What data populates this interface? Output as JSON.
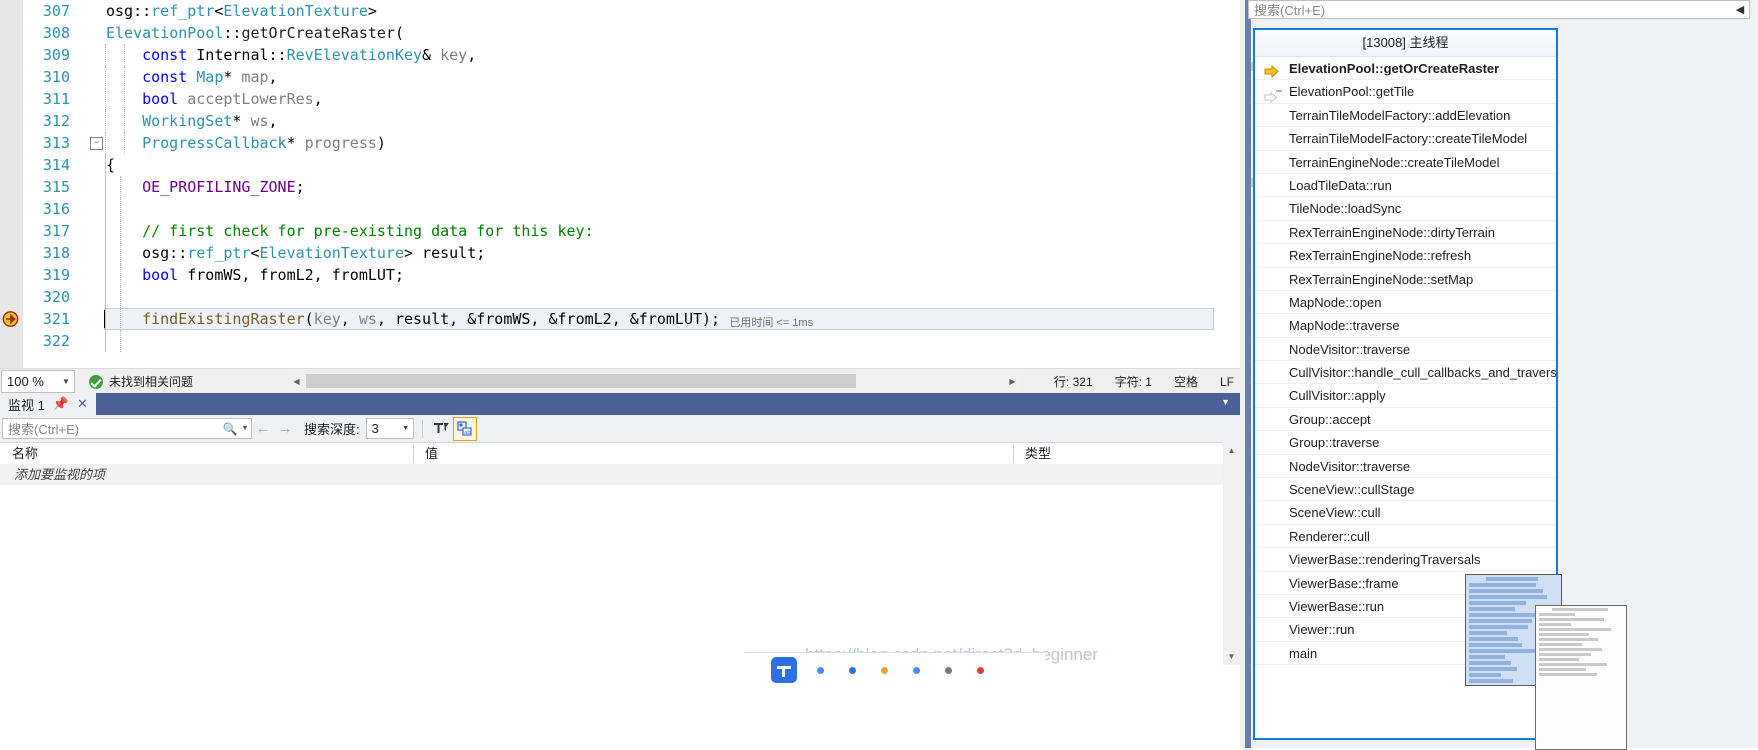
{
  "editor": {
    "lines": [
      {
        "num": "307",
        "indent": 0,
        "tokens": [
          {
            "t": "osg",
            "c": "p"
          },
          {
            "t": "::",
            "c": "p"
          },
          {
            "t": "ref_ptr",
            "c": "t"
          },
          {
            "t": "<",
            "c": "p"
          },
          {
            "t": "ElevationTexture",
            "c": "t"
          },
          {
            "t": ">",
            "c": "p"
          }
        ]
      },
      {
        "num": "308",
        "indent": 0,
        "tokens": [
          {
            "t": "ElevationPool",
            "c": "t"
          },
          {
            "t": "::",
            "c": "p"
          },
          {
            "t": "getOrCreateRaster",
            "c": "id"
          },
          {
            "t": "(",
            "c": "p"
          }
        ]
      },
      {
        "num": "309",
        "indent": 1,
        "tokens": [
          {
            "t": "const",
            "c": "k"
          },
          {
            "t": " ",
            "c": "p"
          },
          {
            "t": "Internal",
            "c": "p"
          },
          {
            "t": "::",
            "c": "p"
          },
          {
            "t": "RevElevationKey",
            "c": "t"
          },
          {
            "t": "&",
            "c": "p"
          },
          {
            "t": " ",
            "c": "p"
          },
          {
            "t": "key",
            "c": "g"
          },
          {
            "t": ",",
            "c": "p"
          }
        ]
      },
      {
        "num": "310",
        "indent": 1,
        "tokens": [
          {
            "t": "const",
            "c": "k"
          },
          {
            "t": " ",
            "c": "p"
          },
          {
            "t": "Map",
            "c": "t"
          },
          {
            "t": "*",
            "c": "p"
          },
          {
            "t": " ",
            "c": "p"
          },
          {
            "t": "map",
            "c": "g"
          },
          {
            "t": ",",
            "c": "p"
          }
        ]
      },
      {
        "num": "311",
        "indent": 1,
        "tokens": [
          {
            "t": "bool",
            "c": "k"
          },
          {
            "t": " ",
            "c": "p"
          },
          {
            "t": "acceptLowerRes",
            "c": "g"
          },
          {
            "t": ",",
            "c": "p"
          }
        ]
      },
      {
        "num": "312",
        "indent": 1,
        "tokens": [
          {
            "t": "WorkingSet",
            "c": "t"
          },
          {
            "t": "*",
            "c": "p"
          },
          {
            "t": " ",
            "c": "p"
          },
          {
            "t": "ws",
            "c": "g"
          },
          {
            "t": ",",
            "c": "p"
          }
        ]
      },
      {
        "num": "313",
        "indent": 1,
        "fold": true,
        "tokens": [
          {
            "t": "ProgressCallback",
            "c": "t"
          },
          {
            "t": "*",
            "c": "p"
          },
          {
            "t": " ",
            "c": "p"
          },
          {
            "t": "progress",
            "c": "g"
          },
          {
            "t": ")",
            "c": "p"
          }
        ]
      },
      {
        "num": "314",
        "indent": 0,
        "tokens": [
          {
            "t": "{",
            "c": "p"
          }
        ]
      },
      {
        "num": "315",
        "indent": 1,
        "tokens": [
          {
            "t": "OE_PROFILING_ZONE",
            "c": "m"
          },
          {
            "t": ";",
            "c": "p"
          }
        ]
      },
      {
        "num": "316",
        "indent": 1,
        "tokens": []
      },
      {
        "num": "317",
        "indent": 1,
        "tokens": [
          {
            "t": "// first check for pre-existing data for this key:",
            "c": "c"
          }
        ]
      },
      {
        "num": "318",
        "indent": 1,
        "tokens": [
          {
            "t": "osg",
            "c": "p"
          },
          {
            "t": "::",
            "c": "p"
          },
          {
            "t": "ref_ptr",
            "c": "t"
          },
          {
            "t": "<",
            "c": "p"
          },
          {
            "t": "ElevationTexture",
            "c": "t"
          },
          {
            "t": "> ",
            "c": "p"
          },
          {
            "t": "result",
            "c": "p"
          },
          {
            "t": ";",
            "c": "p"
          }
        ]
      },
      {
        "num": "319",
        "indent": 1,
        "tokens": [
          {
            "t": "bool",
            "c": "k"
          },
          {
            "t": " ",
            "c": "p"
          },
          {
            "t": "fromWS",
            "c": "p"
          },
          {
            "t": ", ",
            "c": "p"
          },
          {
            "t": "fromL2",
            "c": "p"
          },
          {
            "t": ", ",
            "c": "p"
          },
          {
            "t": "fromLUT",
            "c": "p"
          },
          {
            "t": ";",
            "c": "p"
          }
        ]
      },
      {
        "num": "320",
        "indent": 1,
        "tokens": []
      },
      {
        "num": "321",
        "indent": 1,
        "current": true,
        "tokens": [
          {
            "t": "findExistingRaster",
            "c": "f"
          },
          {
            "t": "(",
            "c": "p"
          },
          {
            "t": "key",
            "c": "g"
          },
          {
            "t": ", ",
            "c": "p"
          },
          {
            "t": "ws",
            "c": "g"
          },
          {
            "t": ", ",
            "c": "p"
          },
          {
            "t": "result",
            "c": "p"
          },
          {
            "t": ", ",
            "c": "p"
          },
          {
            "t": "&fromWS",
            "c": "p"
          },
          {
            "t": ", ",
            "c": "p"
          },
          {
            "t": "&fromL2",
            "c": "p"
          },
          {
            "t": ", ",
            "c": "p"
          },
          {
            "t": "&fromLUT",
            "c": "p"
          },
          {
            "t": ");",
            "c": "p"
          }
        ]
      },
      {
        "num": "322",
        "indent": 1,
        "tokens": []
      }
    ],
    "elapsed_label": "已用时间 <= 1ms"
  },
  "status_bar": {
    "zoom": "100 %",
    "problems": "未找到相关问题",
    "line_label": "行: 321",
    "char_label": "字符: 1",
    "spacing": "空格",
    "eol": "LF"
  },
  "watch": {
    "tab_title": "监视 1",
    "pin_icon": "pin-icon",
    "close_icon": "close-icon",
    "search_placeholder": "搜索(Ctrl+E)",
    "search_icon": "search-icon",
    "prev_icon": "arrow-left-icon",
    "next_icon": "arrow-right-icon",
    "depth_label": "搜索深度:",
    "depth_value": "3",
    "filter_icon": "filter-pin-icon",
    "hex_icon": "hex-display-icon",
    "columns": [
      "名称",
      "值",
      "类型"
    ],
    "empty_row": "添加要监视的项"
  },
  "call_stack": {
    "search_placeholder": "搜索(Ctrl+E)",
    "search_icon": "search-icon",
    "thread_header": "[13008] 主线程",
    "current_frame_icon": "yellow-arrow-icon",
    "frames": [
      {
        "label": "ElevationPool::getOrCreateRaster",
        "state": "current"
      },
      {
        "label": "ElevationPool::getTile",
        "state": "caller"
      },
      {
        "label": "TerrainTileModelFactory::addElevation",
        "state": "normal"
      },
      {
        "label": "TerrainTileModelFactory::createTileModel",
        "state": "normal"
      },
      {
        "label": "TerrainEngineNode::createTileModel",
        "state": "normal"
      },
      {
        "label": "LoadTileData::run",
        "state": "normal"
      },
      {
        "label": "TileNode::loadSync",
        "state": "normal"
      },
      {
        "label": "RexTerrainEngineNode::dirtyTerrain",
        "state": "normal"
      },
      {
        "label": "RexTerrainEngineNode::refresh",
        "state": "normal"
      },
      {
        "label": "RexTerrainEngineNode::setMap",
        "state": "normal"
      },
      {
        "label": "MapNode::open",
        "state": "normal"
      },
      {
        "label": "MapNode::traverse",
        "state": "normal"
      },
      {
        "label": "NodeVisitor::traverse",
        "state": "normal"
      },
      {
        "label": "CullVisitor::handle_cull_callbacks_and_traverse",
        "state": "normal"
      },
      {
        "label": "CullVisitor::apply",
        "state": "normal"
      },
      {
        "label": "Group::accept",
        "state": "normal"
      },
      {
        "label": "Group::traverse",
        "state": "normal"
      },
      {
        "label": "NodeVisitor::traverse",
        "state": "normal"
      },
      {
        "label": "SceneView::cullStage",
        "state": "normal"
      },
      {
        "label": "SceneView::cull",
        "state": "normal"
      },
      {
        "label": "Renderer::cull",
        "state": "normal"
      },
      {
        "label": "ViewerBase::renderingTraversals",
        "state": "normal"
      },
      {
        "label": "ViewerBase::frame",
        "state": "normal"
      },
      {
        "label": "ViewerBase::run",
        "state": "normal"
      },
      {
        "label": "Viewer::run",
        "state": "normal"
      },
      {
        "label": "main",
        "state": "normal"
      }
    ]
  },
  "watermark": "https://blog.csdn.net/direct3d_beginner",
  "colors": {
    "accent_blue": "#0f7fd6",
    "title_blue": "#4c6196",
    "divider_blue": "#6b7fae",
    "keyword": "#0000ff",
    "type": "#2b91af",
    "comment": "#008000",
    "macro": "#6f008a",
    "function": "#795e26",
    "linenum": "#2b91af",
    "ok_green": "#3fa13f",
    "arrow_yellow": "#f0c419"
  }
}
